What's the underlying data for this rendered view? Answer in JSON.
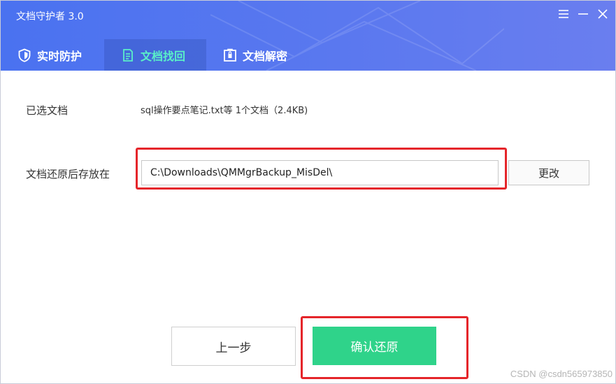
{
  "app": {
    "title": "文档守护者 3.0"
  },
  "tabs": [
    {
      "label": "实时防护",
      "icon": "shield-icon"
    },
    {
      "label": "文档找回",
      "icon": "document-recover-icon",
      "active": true
    },
    {
      "label": "文档解密",
      "icon": "lock-folder-icon"
    }
  ],
  "form": {
    "selected_label": "已选文档",
    "selected_value": "sql操作要点笔记.txt等 1个文档（2.4KB)",
    "save_label": "文档还原后存放在",
    "save_path": "C:\\Downloads\\QMMgrBackup_MisDel\\",
    "change_label": "更改"
  },
  "actions": {
    "prev_label": "上一步",
    "confirm_label": "确认还原"
  },
  "watermark": "CSDN @csdn565973850",
  "colors": {
    "header": "#4f74ef",
    "active_tab_text": "#5af0c8",
    "confirm": "#2fd38a",
    "highlight": "#e5252a"
  }
}
